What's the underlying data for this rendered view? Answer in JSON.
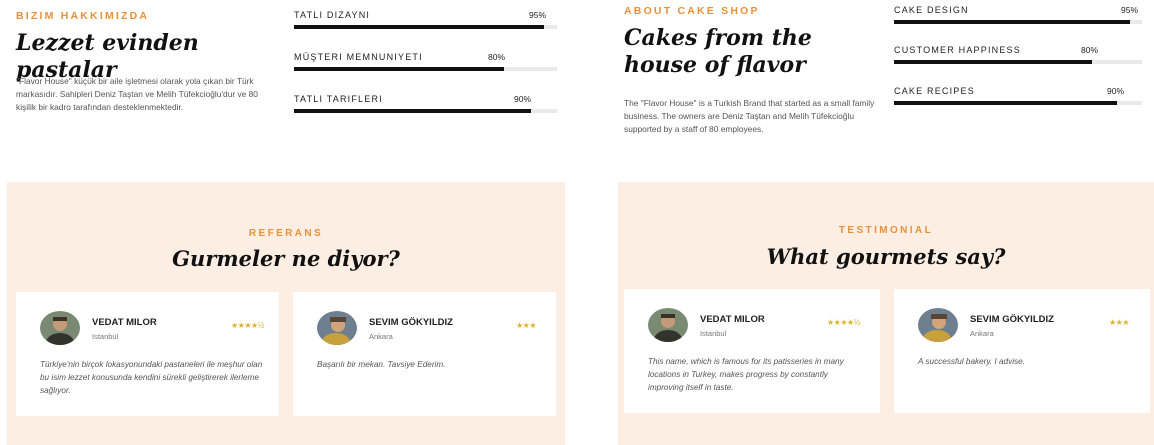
{
  "left": {
    "about": {
      "eyebrow": "BIZIM HAKKIMIZDA",
      "title": "Lezzet evinden pastalar",
      "text": "\"Flavor House\" küçük bir aile işletmesi olarak yola çıkan bir Türk markasıdır. Sahipleri Deniz Taştan ve Melih Tüfekcioğlu'dur ve 80 kişilik bir kadro tarafından desteklenmektedir."
    },
    "skills": [
      {
        "label": "TATLI DIZAYNI",
        "pct_text": "95%",
        "value": 95
      },
      {
        "label": "MÜŞTERI MEMNUNIYETI",
        "pct_text": "80%",
        "value": 80
      },
      {
        "label": "TATLI TARIFLERI",
        "pct_text": "90%",
        "value": 90
      }
    ],
    "testimonials": {
      "eyebrow": "REFERANS",
      "title": "Gurmeler ne diyor?",
      "cards": [
        {
          "name": "VEDAT MILOR",
          "location": "Istanbul",
          "stars": "★★★★½",
          "rating": 4.5,
          "quote": "Türkiye'nin birçok lokasyonundaki pastaneleri ile meşhur olan bu isim lezzet konusunda kendini sürekli geliştirerek ilerleme sağlıyor."
        },
        {
          "name": "SEVIM GÖKYILDIZ",
          "location": "Ankara",
          "stars": "★★★",
          "rating": 3,
          "quote": "Başarılı bir mekan. Tavsiye Ederim."
        }
      ]
    }
  },
  "right": {
    "about": {
      "eyebrow": "ABOUT CAKE SHOP",
      "title": "Cakes from the house of flavor",
      "text": "The \"Flavor House\" is a Turkish Brand that started as a small family business. The owners are Deniz Taştan and Melih Tüfekcioğlu supported by a staff of 80 employees."
    },
    "skills": [
      {
        "label": "CAKE DESIGN",
        "pct_text": "95%",
        "value": 95
      },
      {
        "label": "CUSTOMER HAPPINESS",
        "pct_text": "80%",
        "value": 80
      },
      {
        "label": "CAKE RECIPES",
        "pct_text": "90%",
        "value": 90
      }
    ],
    "testimonials": {
      "eyebrow": "TESTIMONIAL",
      "title": "What gourmets say?",
      "cards": [
        {
          "name": "VEDAT MILOR",
          "location": "Istanbul",
          "stars": "★★★★½",
          "rating": 4.5,
          "quote": "This name, which is famous for its patisseries in many locations in Turkey, makes progress by constantly improving itself in taste."
        },
        {
          "name": "SEVIM GÖKYILDIZ",
          "location": "Ankara",
          "stars": "★★★",
          "rating": 3,
          "quote": "A successful bakery. I advise."
        }
      ]
    }
  },
  "colors": {
    "accent": "#e8913a",
    "panel_bg": "#fdeee4",
    "bar": "#111111",
    "track": "#e9e9e9",
    "stars": "#e0b02a"
  }
}
